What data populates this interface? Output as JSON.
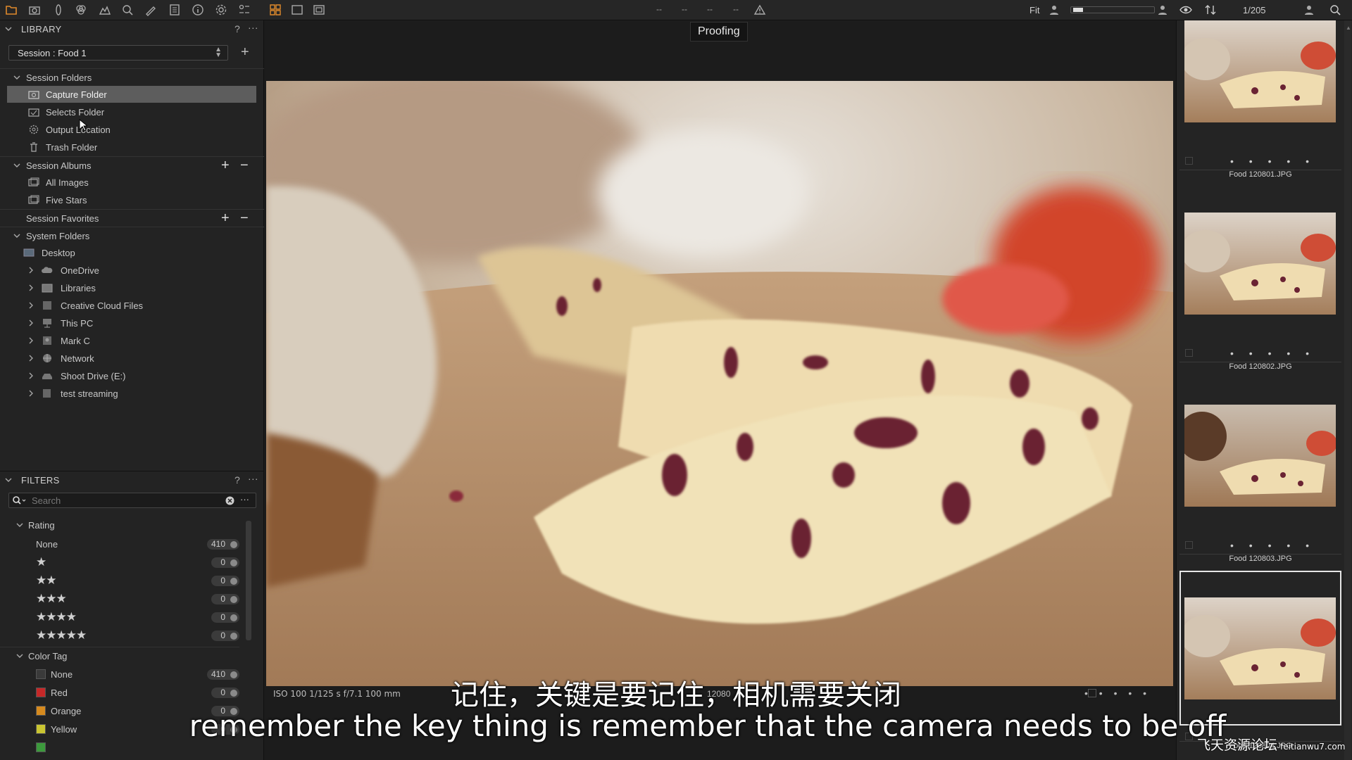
{
  "toolbar": {
    "dashes": [
      "--",
      "--",
      "--",
      "--"
    ],
    "fit": "Fit",
    "counter": "1/205"
  },
  "library": {
    "title": "LIBRARY",
    "help": "?",
    "more": "···",
    "session_select": "Session :  Food 1",
    "session_add": "+",
    "session_folders": {
      "label": "Session Folders",
      "items": [
        {
          "label": "Capture Folder",
          "icon": "capture-folder-icon",
          "selected": true
        },
        {
          "label": "Selects Folder",
          "icon": "selects-folder-icon"
        },
        {
          "label": "Output Location",
          "icon": "gear-icon"
        },
        {
          "label": "Trash Folder",
          "icon": "trash-icon"
        }
      ]
    },
    "session_albums": {
      "label": "Session Albums",
      "items": [
        {
          "label": "All Images",
          "icon": "album-icon"
        },
        {
          "label": "Five Stars",
          "icon": "smart-album-icon"
        }
      ]
    },
    "session_favorites": {
      "label": "Session Favorites"
    },
    "system_folders": {
      "label": "System Folders",
      "items": [
        {
          "label": "Desktop",
          "icon": "desktop-folder-icon"
        },
        {
          "label": "OneDrive",
          "icon": "cloud-icon"
        },
        {
          "label": "Libraries",
          "icon": "folder-icon"
        },
        {
          "label": "Creative Cloud Files",
          "icon": "creative-cloud-icon"
        },
        {
          "label": "This PC",
          "icon": "computer-icon"
        },
        {
          "label": "Mark C",
          "icon": "user-folder-icon"
        },
        {
          "label": "Network",
          "icon": "network-icon"
        },
        {
          "label": "Shoot Drive (E:)",
          "icon": "drive-icon"
        },
        {
          "label": "test streaming",
          "icon": "folder-icon"
        }
      ]
    }
  },
  "filters": {
    "title": "FILTERS",
    "help": "?",
    "more": "···",
    "search_placeholder": "Search",
    "rating": {
      "label": "Rating",
      "rows": [
        {
          "label": "None",
          "stars": 0,
          "count": "410"
        },
        {
          "label": "★",
          "stars": 1,
          "count": "0"
        },
        {
          "label": "★★",
          "stars": 2,
          "count": "0"
        },
        {
          "label": "★★★",
          "stars": 3,
          "count": "0"
        },
        {
          "label": "★★★★",
          "stars": 4,
          "count": "0"
        },
        {
          "label": "★★★★★",
          "stars": 5,
          "count": "0"
        }
      ]
    },
    "color_tag": {
      "label": "Color Tag",
      "rows": [
        {
          "label": "None",
          "color": "#3a3a3a",
          "count": "410"
        },
        {
          "label": "Red",
          "color": "#c62828",
          "count": "0"
        },
        {
          "label": "Orange",
          "color": "#d68a1e",
          "count": "0"
        },
        {
          "label": "Yellow",
          "color": "#c9c531",
          "count": "0"
        }
      ]
    }
  },
  "viewer": {
    "proofing": "Proofing",
    "meta": "ISO 100  1/125 s  f/7.1  100 mm",
    "meta2": "12080",
    "meta_dots": "• • • • •"
  },
  "filmstrip": {
    "thumbs": [
      {
        "name": "Food 120801.JPG",
        "dots": "• • • • •"
      },
      {
        "name": "Food 120802.JPG",
        "dots": "• • • • •"
      },
      {
        "name": "Food 120803.JPG",
        "dots": "• • • • •"
      },
      {
        "name": "Food 120804.JPG",
        "dots": "• • • • •",
        "active": true
      }
    ]
  },
  "subtitles": {
    "cn": "记住，关键是要记住，相机需要关闭",
    "en": "remember the key thing is remember that the camera needs to be off"
  },
  "watermark": {
    "text": "飞天资源论坛",
    "url": "feitianwu7.com"
  },
  "colors": {
    "accent": "#e08a2c",
    "panel": "#232323",
    "selected": "#5d5d5d"
  }
}
